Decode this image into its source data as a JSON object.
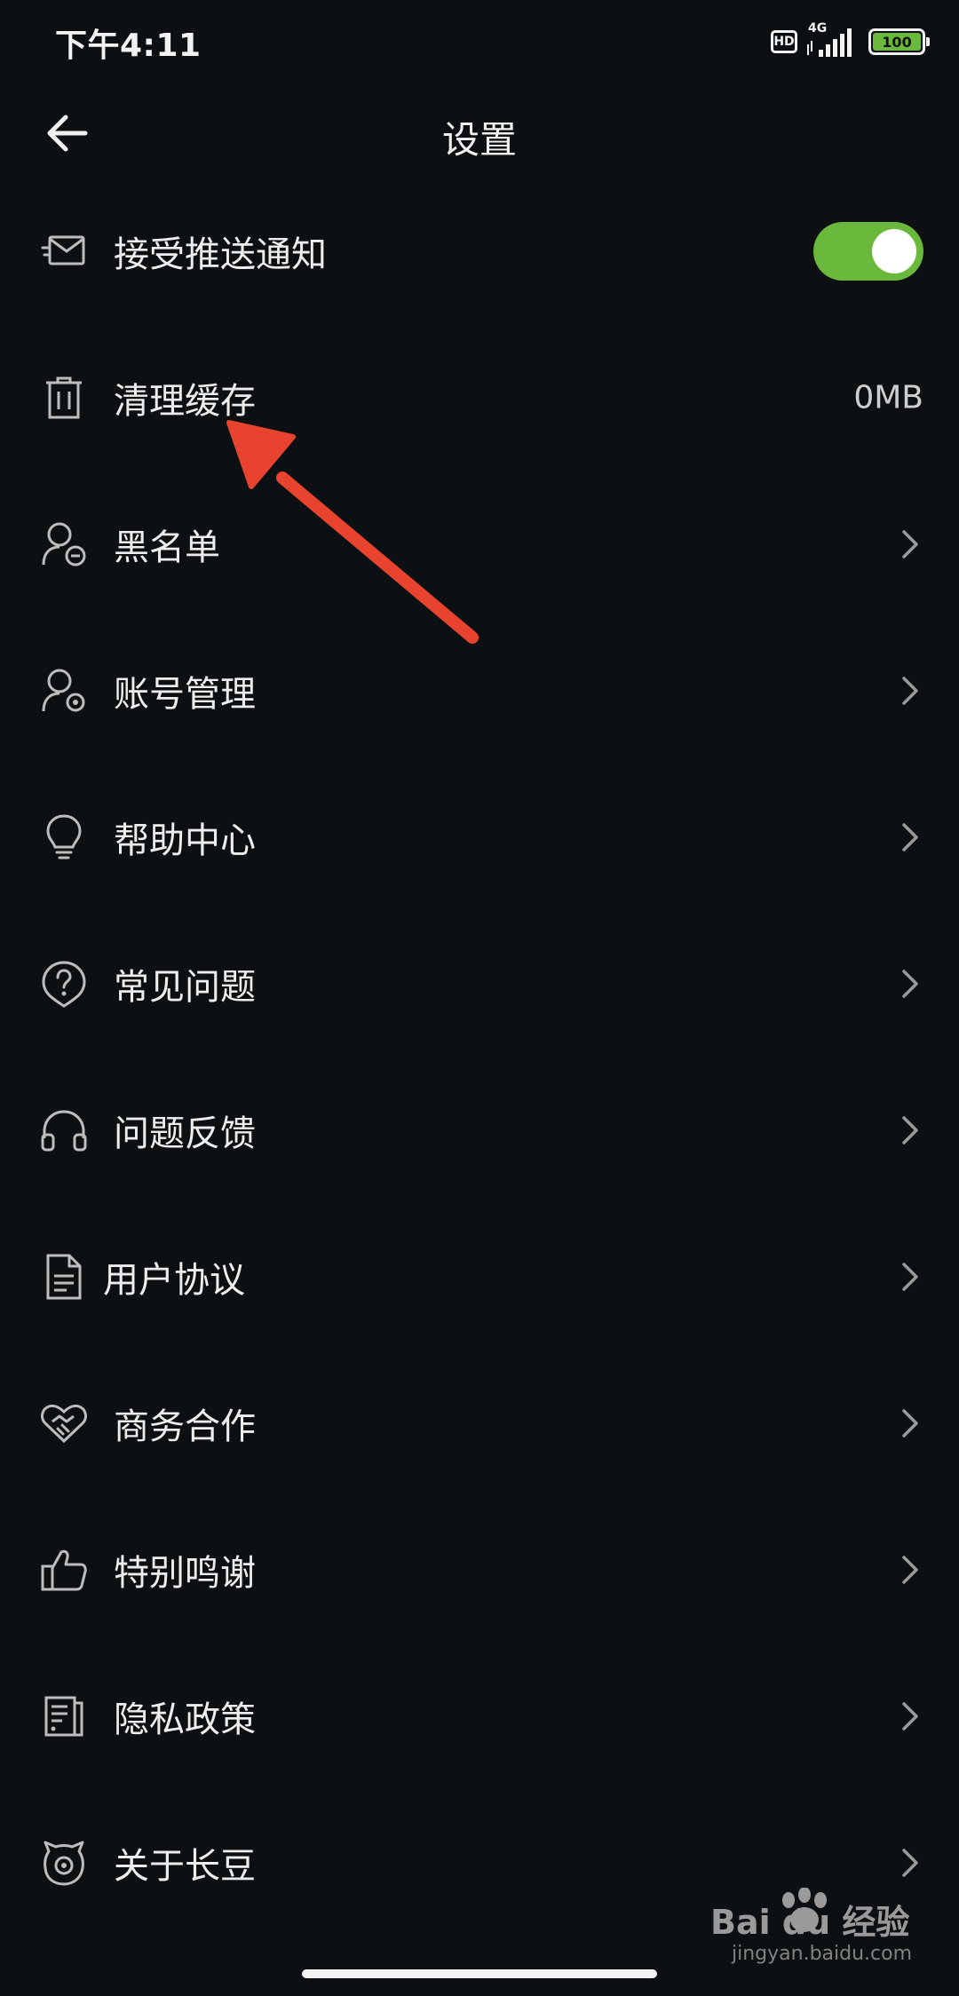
{
  "status_bar": {
    "time": "下午4:11",
    "hd_label": "HD",
    "network_label": "4G",
    "battery_label": "100"
  },
  "header": {
    "title": "设置"
  },
  "settings": [
    {
      "label": "接受推送通知",
      "icon": "message-icon",
      "control": "toggle",
      "toggle_on": true
    },
    {
      "label": "清理缓存",
      "icon": "trash-icon",
      "control": "value",
      "value": "0MB"
    },
    {
      "label": "黑名单",
      "icon": "user-blocked-icon",
      "control": "chevron"
    },
    {
      "label": "账号管理",
      "icon": "user-settings-icon",
      "control": "chevron"
    },
    {
      "label": "帮助中心",
      "icon": "lightbulb-icon",
      "control": "chevron"
    },
    {
      "label": "常见问题",
      "icon": "question-icon",
      "control": "chevron"
    },
    {
      "label": "问题反馈",
      "icon": "headphones-icon",
      "control": "chevron"
    },
    {
      "label": "用户协议",
      "icon": "document-icon",
      "control": "chevron"
    },
    {
      "label": "商务合作",
      "icon": "handshake-icon",
      "control": "chevron"
    },
    {
      "label": "特别鸣谢",
      "icon": "thumbs-up-icon",
      "control": "chevron"
    },
    {
      "label": "隐私政策",
      "icon": "policy-icon",
      "control": "chevron"
    },
    {
      "label": "关于长豆",
      "icon": "app-mascot-icon",
      "control": "chevron"
    }
  ],
  "watermark": {
    "brand": "Bai du 经验",
    "site": "jingyan.baidu.com"
  },
  "colors": {
    "background": "#0d1013",
    "accent_green": "#6ab93c",
    "annotation_red": "#e8432f"
  }
}
